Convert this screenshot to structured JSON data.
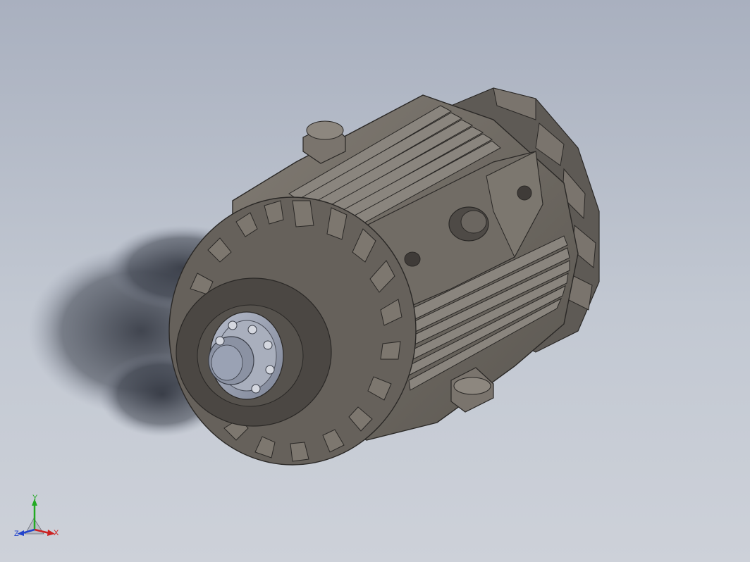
{
  "viewport": {
    "background_top": "#a9b0bf",
    "background_bottom": "#cdd1d9",
    "model_color": "#6b6660",
    "model_dark": "#4f4b47",
    "model_light": "#8a857e",
    "hub_color": "#9aa2b4"
  },
  "triad": {
    "x_label": "X",
    "y_label": "Y",
    "z_label": "Z",
    "x_color": "#cc2222",
    "y_color": "#22aa22",
    "z_color": "#2244cc"
  }
}
